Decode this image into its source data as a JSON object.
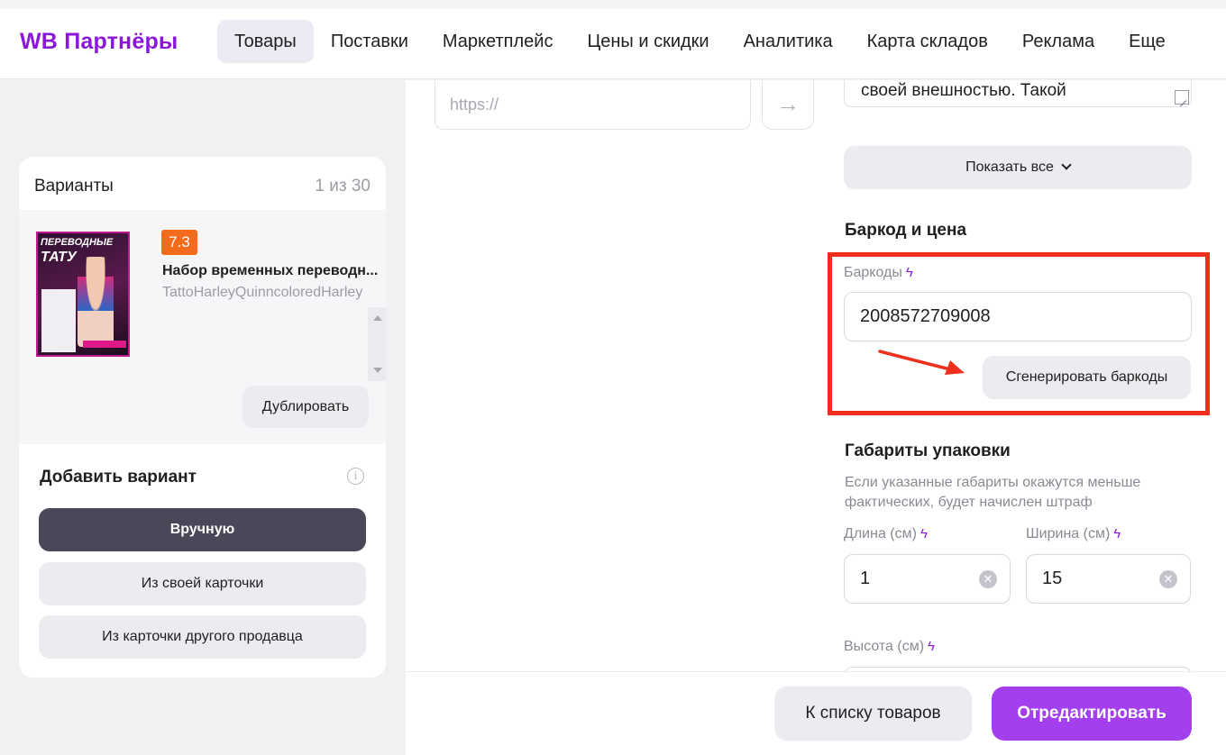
{
  "header": {
    "logo": "WB Партнёры",
    "nav": [
      "Товары",
      "Поставки",
      "Маркетплейс",
      "Цены и скидки",
      "Аналитика",
      "Карта складов",
      "Реклама",
      "Еще"
    ],
    "active_nav": "Товары"
  },
  "variants": {
    "title": "Варианты",
    "count": "1 из 30",
    "item": {
      "rating": "7.3",
      "name": "Набор временных переводн...",
      "article": "TattoHarleyQuinncoloredHarley",
      "thumb_text_1": "ПЕРЕВОДНЫЕ",
      "thumb_text_2": "ТАТУ"
    },
    "duplicate_label": "Дублировать",
    "add_title": "Добавить вариант",
    "add_options": [
      "Вручную",
      "Из своей карточки",
      "Из карточки другого продавца"
    ]
  },
  "media": {
    "url_placeholder": "https://"
  },
  "description": {
    "visible_text": "своей внешностью. Такой",
    "show_all_label": "Показать все"
  },
  "barcode_section": {
    "title": "Баркод и цена",
    "barcodes_label": "Баркоды",
    "barcode_value": "2008572709008",
    "generate_label": "Сгенерировать баркоды"
  },
  "dimensions": {
    "title": "Габариты упаковки",
    "hint": "Если указанные габариты окажутся меньше фактических, будет начислен штраф",
    "length_label": "Длина (см)",
    "length_value": "1",
    "width_label": "Ширина (см)",
    "width_value": "15",
    "height_label": "Высота (см)"
  },
  "footer": {
    "back_label": "К списку товаров",
    "edit_label": "Отредактировать"
  },
  "colors": {
    "brand": "#8b18d8",
    "primary_button": "#a43ff0",
    "highlight_frame": "#ee2f1c",
    "rating_badge": "#f36b1c"
  }
}
